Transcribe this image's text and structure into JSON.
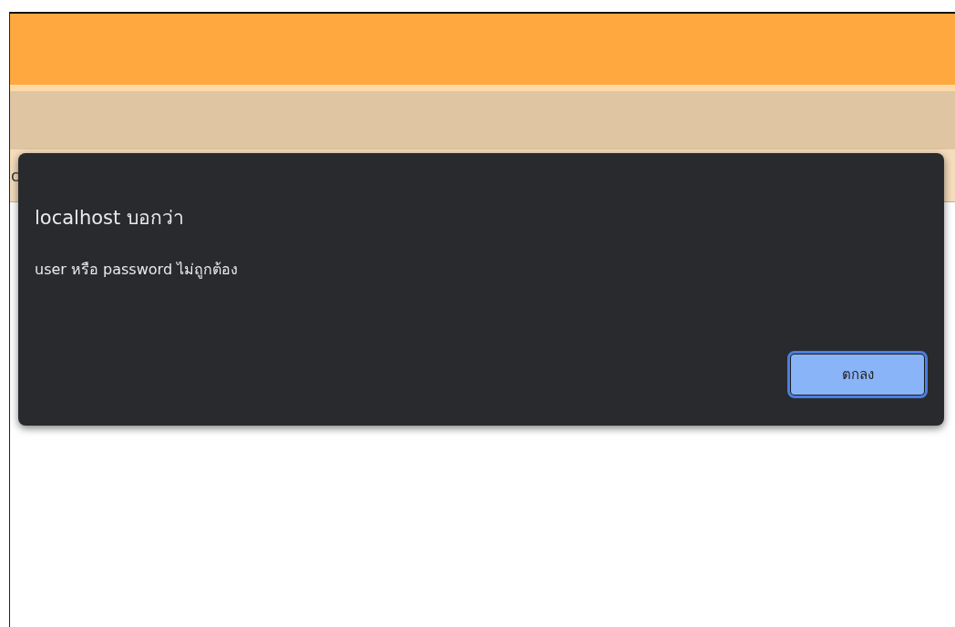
{
  "page": {
    "text_fragment": "c"
  },
  "dialog": {
    "title": "localhost บอกว่า",
    "message": "user หรือ  password ไม่ถูกต้อง",
    "buttons": [
      {
        "label": "ตกลง",
        "focused": true
      }
    ]
  }
}
